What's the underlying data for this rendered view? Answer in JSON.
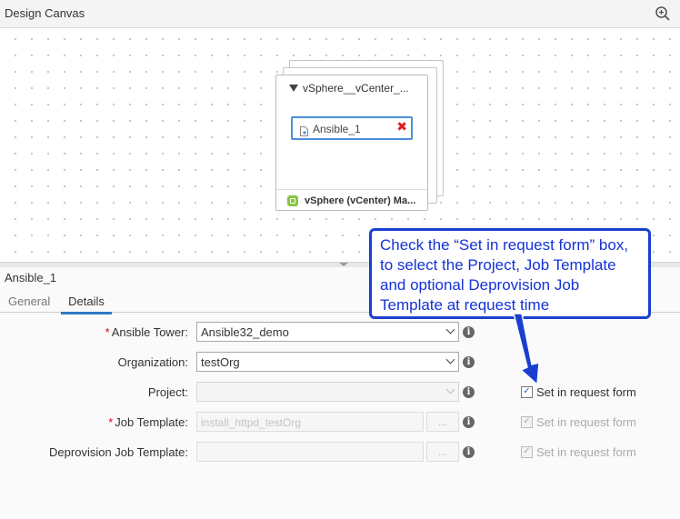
{
  "canvas": {
    "title": "Design Canvas",
    "zoom_icon": "zoom-in-icon",
    "card": {
      "title": "vSphere__vCenter_...",
      "node_label": "Ansible_1",
      "node_icon": "ansible-component-icon",
      "remove_icon": "close-icon",
      "footer_label": "vSphere (vCenter) Ma...",
      "footer_icon": "vsphere-machine-icon"
    }
  },
  "details": {
    "title": "Ansible_1",
    "tabs": [
      {
        "label": "General",
        "active": false
      },
      {
        "label": "Details",
        "active": true
      }
    ],
    "fields": [
      {
        "label": "Ansible Tower:",
        "required": true,
        "value": "Ansible32_demo",
        "checkbox": null
      },
      {
        "label": "Organization:",
        "required": false,
        "value": "testOrg",
        "checkbox": null
      },
      {
        "label": "Project:",
        "required": false,
        "value": "",
        "checkbox": {
          "label": "Set in request form",
          "checked": true,
          "enabled": true
        }
      },
      {
        "label": "Job Template:",
        "required": true,
        "value": "install_httpd_testOrg",
        "checkbox": {
          "label": "Set in request form",
          "checked": true,
          "enabled": false
        }
      },
      {
        "label": "Deprovision Job Template:",
        "required": false,
        "value": "",
        "checkbox": {
          "label": "Set in request form",
          "checked": true,
          "enabled": false
        }
      }
    ],
    "required_marker": "*",
    "info_glyph": "i",
    "ellipsis_label": "...",
    "check_glyph": "✓"
  },
  "callout": {
    "text": "Check the “Set in request form” box, to select the Project, Job Template and optional Deprovision Job Template at request time",
    "color": "#1a3fd0"
  }
}
